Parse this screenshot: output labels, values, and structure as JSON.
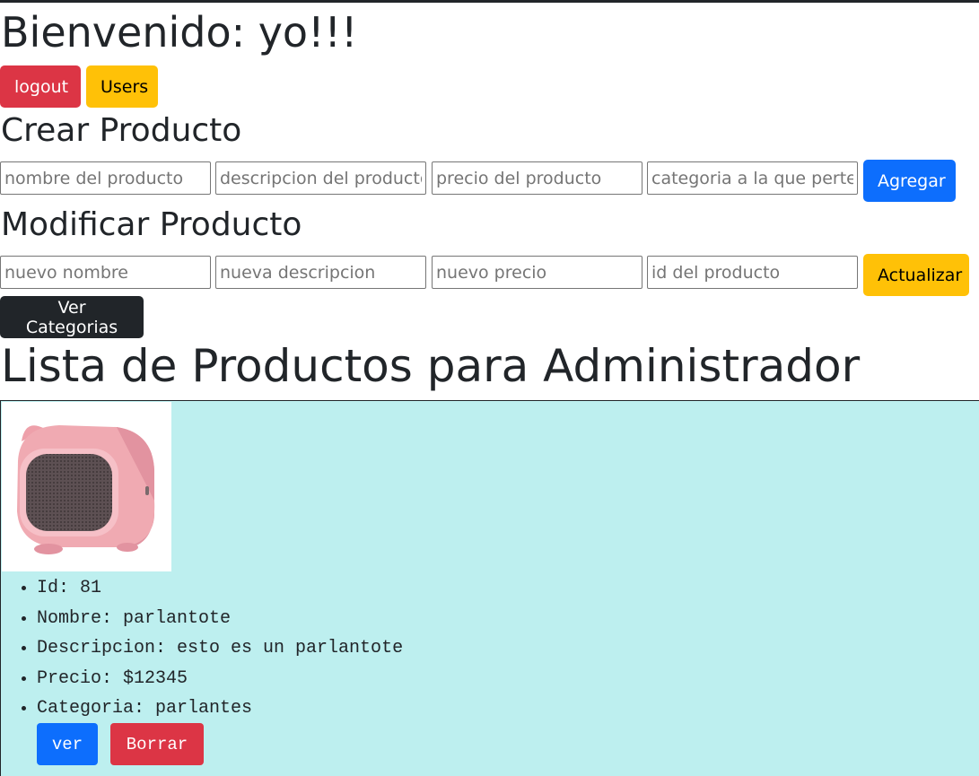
{
  "header": {
    "welcome": "Bienvenido: yo!!!",
    "logout_label": "logout",
    "users_label": "Users"
  },
  "create": {
    "title": "Crear Producto",
    "name_placeholder": "nombre del producto",
    "description_placeholder": "descripcion del producto",
    "price_placeholder": "precio del producto",
    "category_placeholder": "categoria a la que pertenece",
    "submit_label": "Agregar"
  },
  "update": {
    "title": "Modificar Producto",
    "name_placeholder": "nuevo nombre",
    "description_placeholder": "nueva descripcion",
    "price_placeholder": "nuevo precio",
    "id_placeholder": "id del producto",
    "submit_label": "Actualizar"
  },
  "categories_button": "Ver Categorias",
  "list": {
    "title": "Lista de Productos para Administrador",
    "products": [
      {
        "id": "Id: 81",
        "name": "Nombre: parlantote",
        "description": "Descripcion: esto es un parlantote",
        "price": "Precio: $12345",
        "category": "Categoria: parlantes",
        "view_label": "ver",
        "delete_label": "Borrar"
      }
    ]
  },
  "colors": {
    "danger": "#dc3545",
    "warning": "#ffc107",
    "primary": "#0d6efd",
    "dark": "#212529",
    "card_bg": "#bdefef",
    "product_pink": "#f0aab2"
  }
}
